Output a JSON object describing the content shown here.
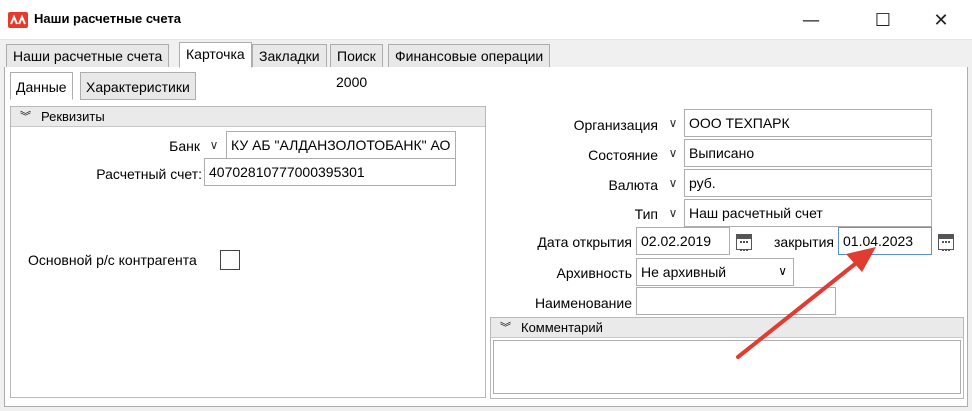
{
  "window": {
    "title": "Наши расчетные счета",
    "minimize_glyph": "—",
    "maximize_glyph": "☐",
    "close_glyph": "✕"
  },
  "tabs": [
    {
      "label": "Наши расчетные счета"
    },
    {
      "label": "Карточка",
      "active": true
    },
    {
      "label": "Закладки"
    },
    {
      "label": "Поиск"
    },
    {
      "label": "Финансовые операции"
    }
  ],
  "subtabs": [
    {
      "label": "Данные",
      "active": true
    },
    {
      "label": "Характеристики"
    }
  ],
  "code_value": "2000",
  "requisites": {
    "header": "Реквизиты",
    "bank_label": "Банк",
    "bank_value": "КУ АБ \"АЛДАНЗОЛОТОБАНК\" АО",
    "account_label": "Расчетный счет:",
    "account_value": "40702810777000395301",
    "main_account_label": "Основной р/с контрагента",
    "main_account_checked": false
  },
  "details": {
    "org_label": "Организация",
    "org_value": "ООО ТЕХПАРК",
    "state_label": "Состояние",
    "state_value": "Выписано",
    "currency_label": "Валюта",
    "currency_value": "руб.",
    "type_label": "Тип",
    "type_value": "Наш расчетный счет",
    "open_date_label": "Дата открытия",
    "open_date_value": "02.02.2019",
    "close_date_label": "закрытия",
    "close_date_value": "01.04.2023",
    "archive_label": "Архивность",
    "archive_value": "Не архивный",
    "name_label": "Наименование",
    "name_value": ""
  },
  "comment": {
    "header": "Комментарий",
    "value": ""
  },
  "annotation_color": "#e03c31"
}
